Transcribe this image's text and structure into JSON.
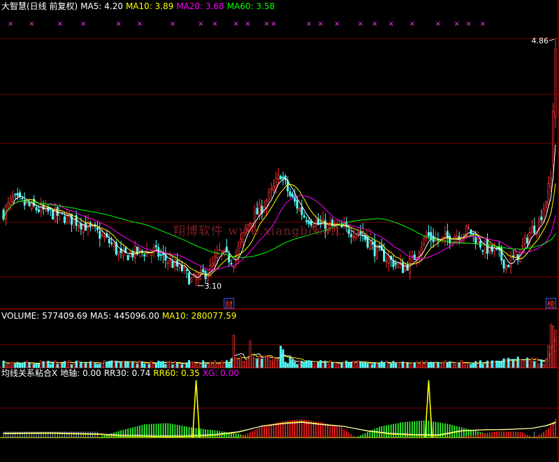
{
  "headers": {
    "price": {
      "stock_label": "大智慧(日线 前复权)",
      "ma5": "MA5: 4.20",
      "ma10": "MA10: 3.89",
      "ma20": "MA20: 3.68",
      "ma60": "MA60: 3.58"
    },
    "volume": {
      "volume": "VOLUME: 577409.69",
      "ma5": "MA5: 445096.00",
      "ma10": "MA10: 280077.59"
    },
    "indicator": {
      "name": "均线关系粘合X",
      "diaxis": "地轴: 0.00",
      "rr30": "RR30: 0.74",
      "rr60": "RR60: 0.35",
      "xg": "XG: 0.00"
    }
  },
  "watermark": "翔博软件 www.xiangbosoft.com",
  "colors": {
    "up": "#ff3030",
    "down": "#54ffff",
    "ma5": "#ffffff",
    "ma10": "#ffff00",
    "ma20": "#ff00ff",
    "ma60": "#00ff00",
    "grid": "#7a0000",
    "marker": "#ff44ff",
    "label": "#ff4040"
  },
  "chart_data": [
    {
      "type": "candlestick",
      "name": "price",
      "high_label": "4.86",
      "low_label": "3.10",
      "markers": [
        {
          "index": 96,
          "text": "财"
        },
        {
          "index": 233,
          "text": "榜"
        }
      ],
      "top_marker_symbol": "×",
      "top_marker_indices": [
        3,
        12,
        24,
        34,
        49,
        58,
        72,
        84,
        90,
        99,
        104,
        112,
        115,
        130,
        135,
        142,
        152,
        158,
        165,
        174,
        185,
        193,
        198,
        204
      ],
      "legend": [
        "MA5",
        "MA10",
        "MA20",
        "MA60"
      ],
      "anchors": [
        [
          0,
          3.62
        ],
        [
          4,
          3.72
        ],
        [
          12,
          3.66
        ],
        [
          20,
          3.62
        ],
        [
          28,
          3.58
        ],
        [
          34,
          3.54
        ],
        [
          40,
          3.48
        ],
        [
          46,
          3.4
        ],
        [
          50,
          3.31
        ],
        [
          56,
          3.34
        ],
        [
          64,
          3.35
        ],
        [
          70,
          3.28
        ],
        [
          76,
          3.22
        ],
        [
          80,
          3.14
        ],
        [
          84,
          3.17
        ],
        [
          88,
          3.22
        ],
        [
          92,
          3.34
        ],
        [
          98,
          3.28
        ],
        [
          104,
          3.54
        ],
        [
          110,
          3.66
        ],
        [
          114,
          3.76
        ],
        [
          118,
          3.9
        ],
        [
          122,
          3.74
        ],
        [
          128,
          3.6
        ],
        [
          134,
          3.54
        ],
        [
          140,
          3.52
        ],
        [
          146,
          3.5
        ],
        [
          152,
          3.48
        ],
        [
          158,
          3.36
        ],
        [
          164,
          3.29
        ],
        [
          170,
          3.23
        ],
        [
          174,
          3.28
        ],
        [
          180,
          3.46
        ],
        [
          186,
          3.42
        ],
        [
          192,
          3.46
        ],
        [
          198,
          3.5
        ],
        [
          204,
          3.38
        ],
        [
          210,
          3.34
        ],
        [
          214,
          3.25
        ],
        [
          220,
          3.34
        ],
        [
          224,
          3.48
        ],
        [
          228,
          3.56
        ],
        [
          231,
          3.72
        ],
        [
          233,
          3.86
        ],
        [
          234,
          4.2
        ],
        [
          235,
          4.78
        ]
      ]
    },
    {
      "type": "bar",
      "name": "VOLUME",
      "legend": [
        "VOLUME",
        "MA5",
        "MA10"
      ],
      "spikes": [
        {
          "index": 98,
          "value": 450000
        },
        {
          "index": 105,
          "value": 370000
        },
        {
          "index": 118,
          "value": 300000
        },
        {
          "index": 119,
          "value": 250000
        },
        {
          "index": 232,
          "value": 300000
        },
        {
          "index": 233,
          "value": 600000
        },
        {
          "index": 234,
          "value": 577409.69
        },
        {
          "index": 235,
          "value": 520000
        }
      ]
    },
    {
      "type": "bar",
      "name": "均线关系粘合X",
      "legend": [
        "地轴",
        "RR30",
        "RR60",
        "XG"
      ],
      "spikes": [
        82,
        181
      ],
      "hump_anchors": [
        [
          0,
          0.2
        ],
        [
          20,
          0.22
        ],
        [
          40,
          0.16
        ],
        [
          50,
          0.08
        ],
        [
          60,
          0.06
        ],
        [
          70,
          0.04
        ],
        [
          80,
          0.06
        ],
        [
          90,
          0.12
        ],
        [
          100,
          0.28
        ],
        [
          110,
          0.6
        ],
        [
          120,
          0.76
        ],
        [
          127,
          0.82
        ],
        [
          135,
          0.7
        ],
        [
          145,
          0.58
        ],
        [
          155,
          0.34
        ],
        [
          165,
          0.18
        ],
        [
          175,
          0.12
        ],
        [
          185,
          0.1
        ],
        [
          195,
          0.34
        ],
        [
          205,
          0.4
        ],
        [
          215,
          0.42
        ],
        [
          225,
          0.48
        ],
        [
          231,
          0.62
        ],
        [
          235,
          0.8
        ]
      ],
      "green_anchors": [
        [
          0,
          0.0
        ],
        [
          40,
          0.0
        ],
        [
          50,
          0.3
        ],
        [
          60,
          0.55
        ],
        [
          70,
          0.6
        ],
        [
          80,
          0.42
        ],
        [
          90,
          0.3
        ],
        [
          100,
          0.15
        ],
        [
          106,
          0.0
        ],
        [
          150,
          0.0
        ],
        [
          160,
          0.45
        ],
        [
          170,
          0.64
        ],
        [
          180,
          0.72
        ],
        [
          190,
          0.55
        ],
        [
          200,
          0.3
        ],
        [
          208,
          0.1
        ],
        [
          212,
          0.0
        ],
        [
          235,
          0.0
        ]
      ],
      "red_anchors": [
        [
          0,
          0.0
        ],
        [
          100,
          0.0
        ],
        [
          104,
          0.2
        ],
        [
          110,
          0.55
        ],
        [
          120,
          0.82
        ],
        [
          127,
          0.9
        ],
        [
          136,
          0.72
        ],
        [
          144,
          0.5
        ],
        [
          150,
          0.0
        ],
        [
          195,
          0.0
        ],
        [
          200,
          0.12
        ],
        [
          210,
          0.3
        ],
        [
          220,
          0.28
        ],
        [
          226,
          0.0
        ],
        [
          229,
          0.2
        ],
        [
          232,
          0.45
        ],
        [
          235,
          0.9
        ]
      ]
    }
  ]
}
